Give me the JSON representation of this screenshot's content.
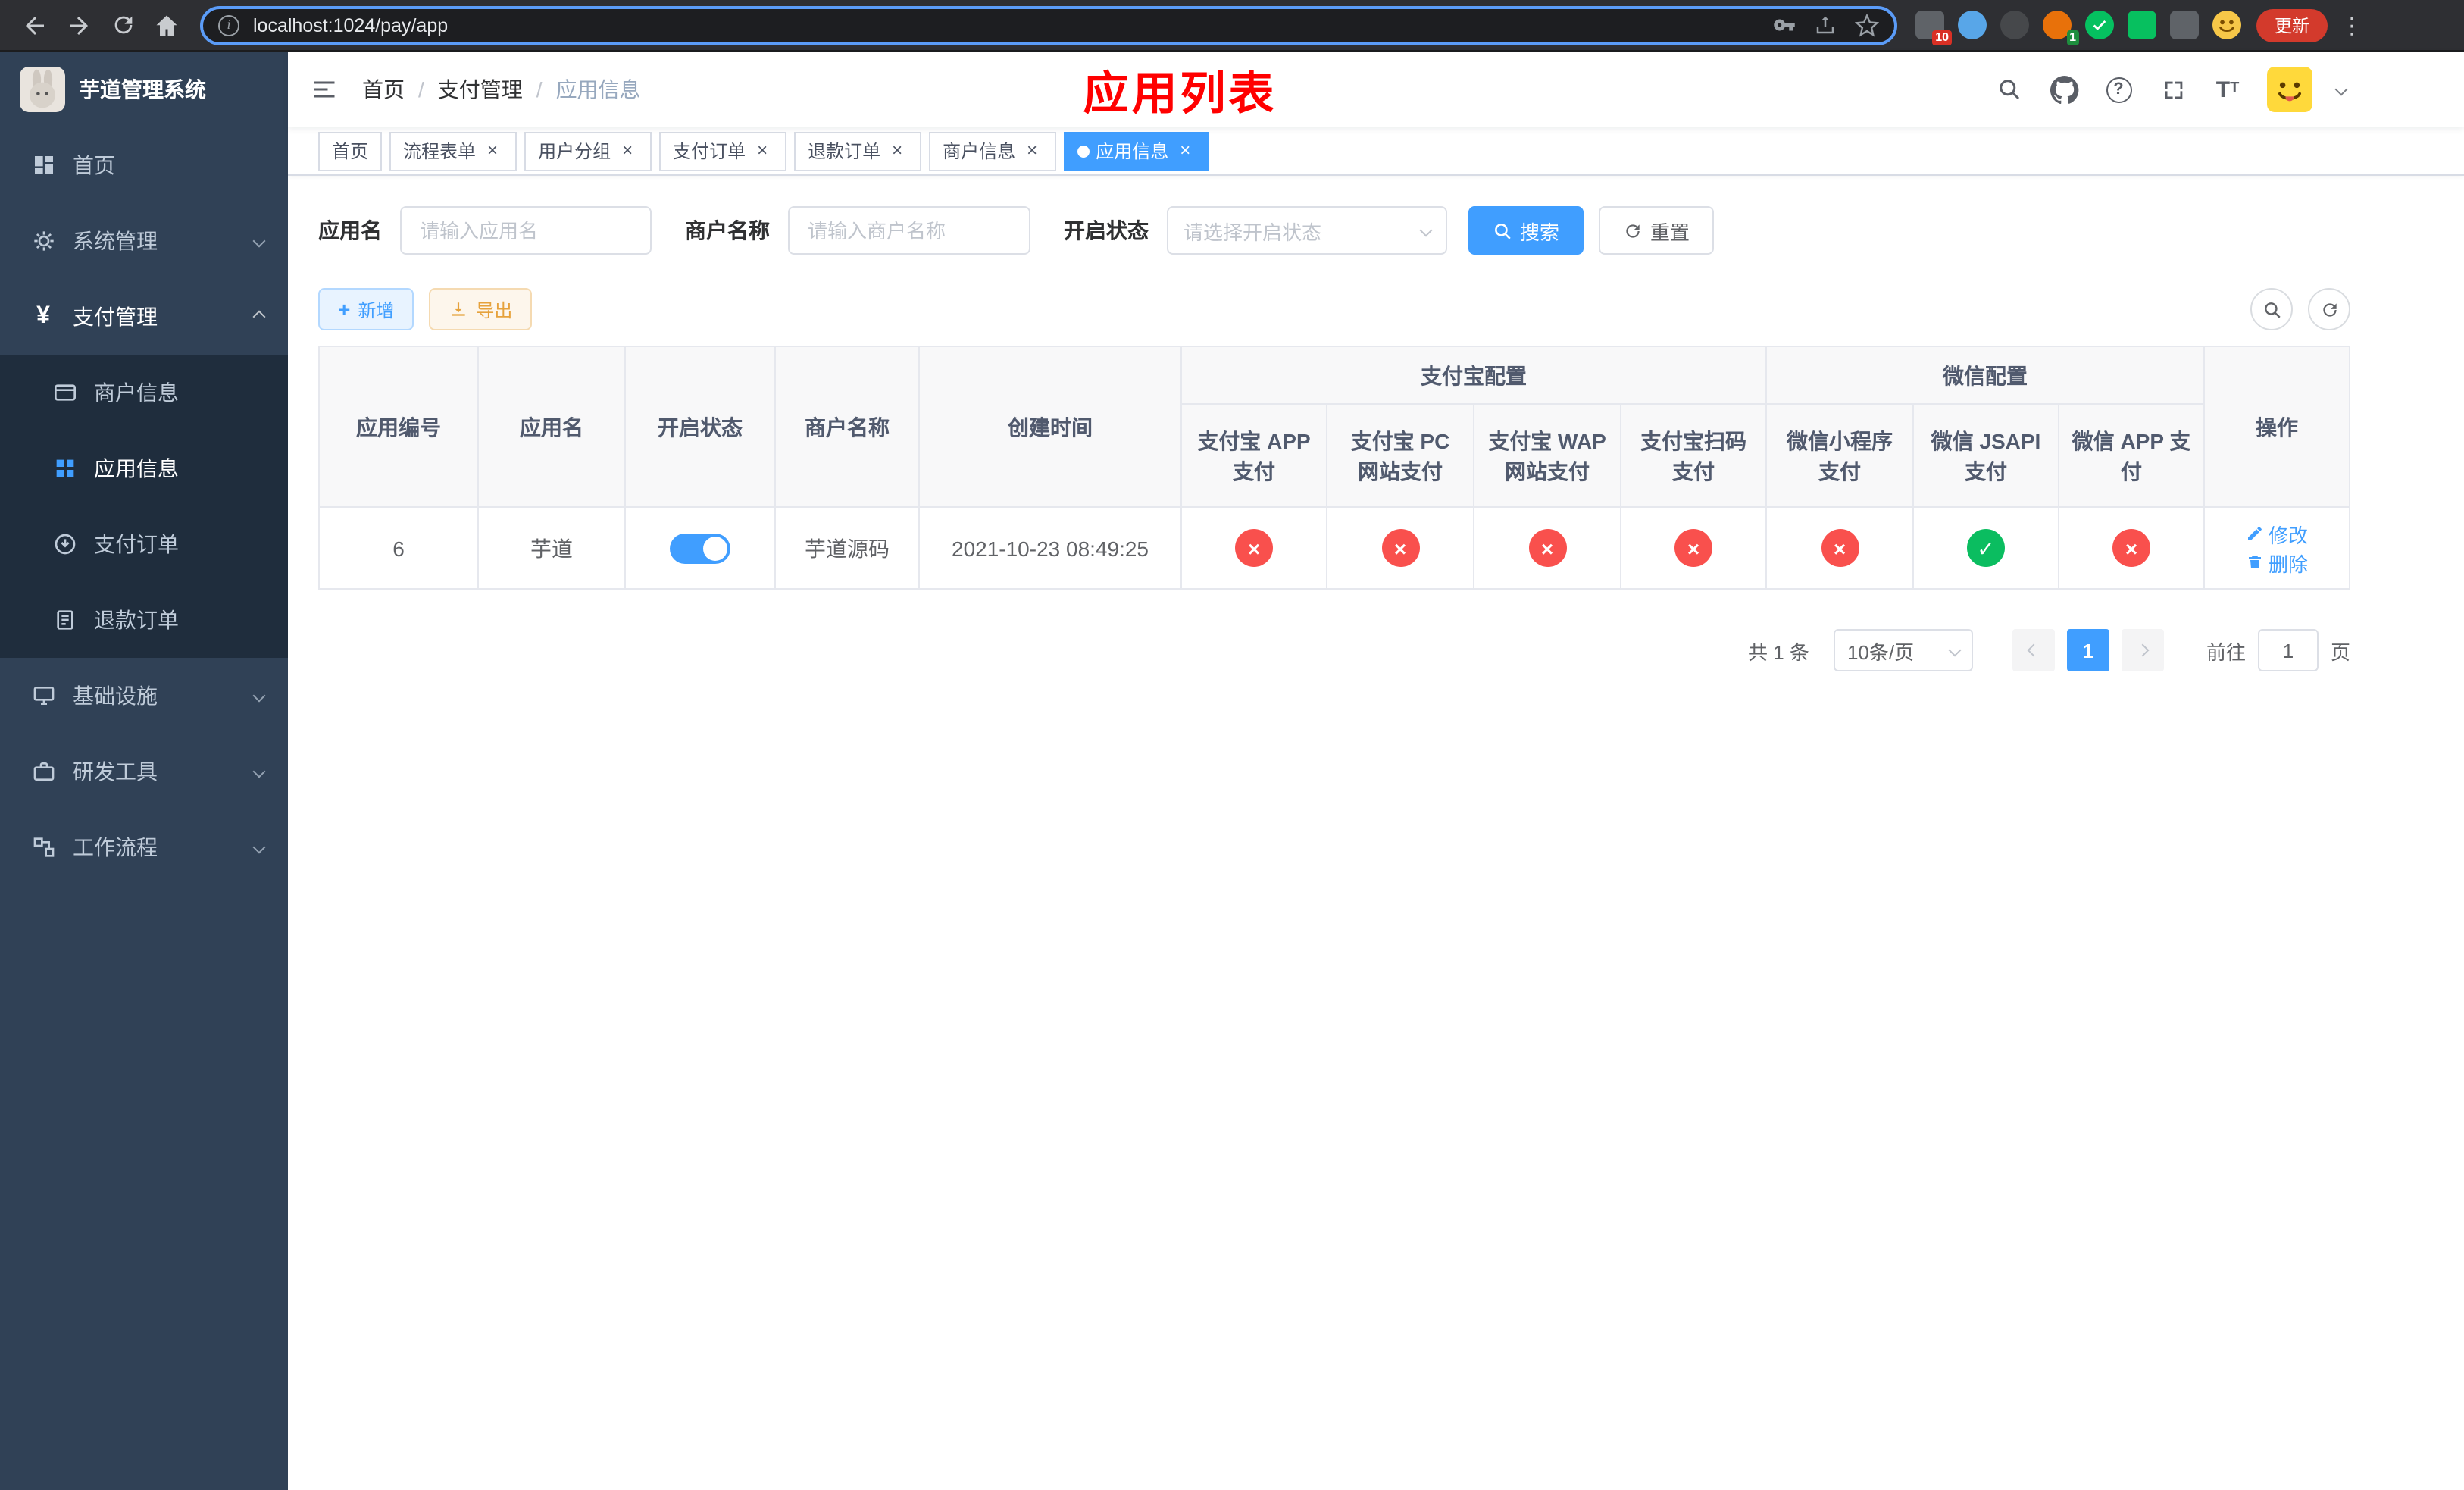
{
  "colors": {
    "accent": "#409eff",
    "danger": "#f9504d",
    "success": "#0bbd60",
    "warning": "#e6a23c",
    "title-red": "#ff0000",
    "sidebar-bg": "#304156",
    "submenu-bg": "#1f2d3d"
  },
  "browser": {
    "url": "localhost:1024/pay/app",
    "update_label": "更新",
    "ext_badge_a": "10",
    "ext_badge_b": "1"
  },
  "sidebar": {
    "logo": "芋道管理系统",
    "items": [
      {
        "label": "首页"
      },
      {
        "label": "系统管理"
      },
      {
        "label": "支付管理",
        "children": [
          {
            "label": "商户信息"
          },
          {
            "label": "应用信息"
          },
          {
            "label": "支付订单"
          },
          {
            "label": "退款订单"
          }
        ]
      },
      {
        "label": "基础设施"
      },
      {
        "label": "研发工具"
      },
      {
        "label": "工作流程"
      }
    ]
  },
  "header": {
    "breadcrumb": [
      "首页",
      "支付管理",
      "应用信息"
    ],
    "sep": "/",
    "title": "应用列表"
  },
  "tags": [
    {
      "label": "首页"
    },
    {
      "label": "流程表单"
    },
    {
      "label": "用户分组"
    },
    {
      "label": "支付订单"
    },
    {
      "label": "退款订单"
    },
    {
      "label": "商户信息"
    },
    {
      "label": "应用信息"
    }
  ],
  "filters": {
    "app_name_label": "应用名",
    "app_name_placeholder": "请输入应用名",
    "merchant_label": "商户名称",
    "merchant_placeholder": "请输入商户名称",
    "status_label": "开启状态",
    "status_placeholder": "请选择开启状态",
    "search_label": "搜索",
    "reset_label": "重置"
  },
  "toolbar": {
    "add_label": "新增",
    "export_label": "导出"
  },
  "table": {
    "columns": {
      "id": "应用编号",
      "name": "应用名",
      "status": "开启状态",
      "merchant": "商户名称",
      "created": "创建时间",
      "actions": "操作"
    },
    "groups": {
      "alipay": "支付宝配置",
      "wechat": "微信配置"
    },
    "alipay_cols": [
      "支付宝 APP 支付",
      "支付宝 PC 网站支付",
      "支付宝 WAP 网站支付",
      "支付宝扫码支付"
    ],
    "wechat_cols": [
      "微信小程序支付",
      "微信 JSAPI 支付",
      "微信 APP 支付"
    ],
    "row": {
      "id": "6",
      "name": "芋道",
      "enabled": true,
      "merchant": "芋道源码",
      "created": "2021-10-23 08:49:25",
      "alipay": [
        false,
        false,
        false,
        false
      ],
      "wechat": [
        false,
        true,
        false
      ],
      "edit_label": "修改",
      "delete_label": "删除"
    }
  },
  "pagination": {
    "total": "共 1 条",
    "size": "10条/页",
    "page": "1",
    "goto": "前往",
    "unit": "页",
    "goto_value": "1"
  }
}
